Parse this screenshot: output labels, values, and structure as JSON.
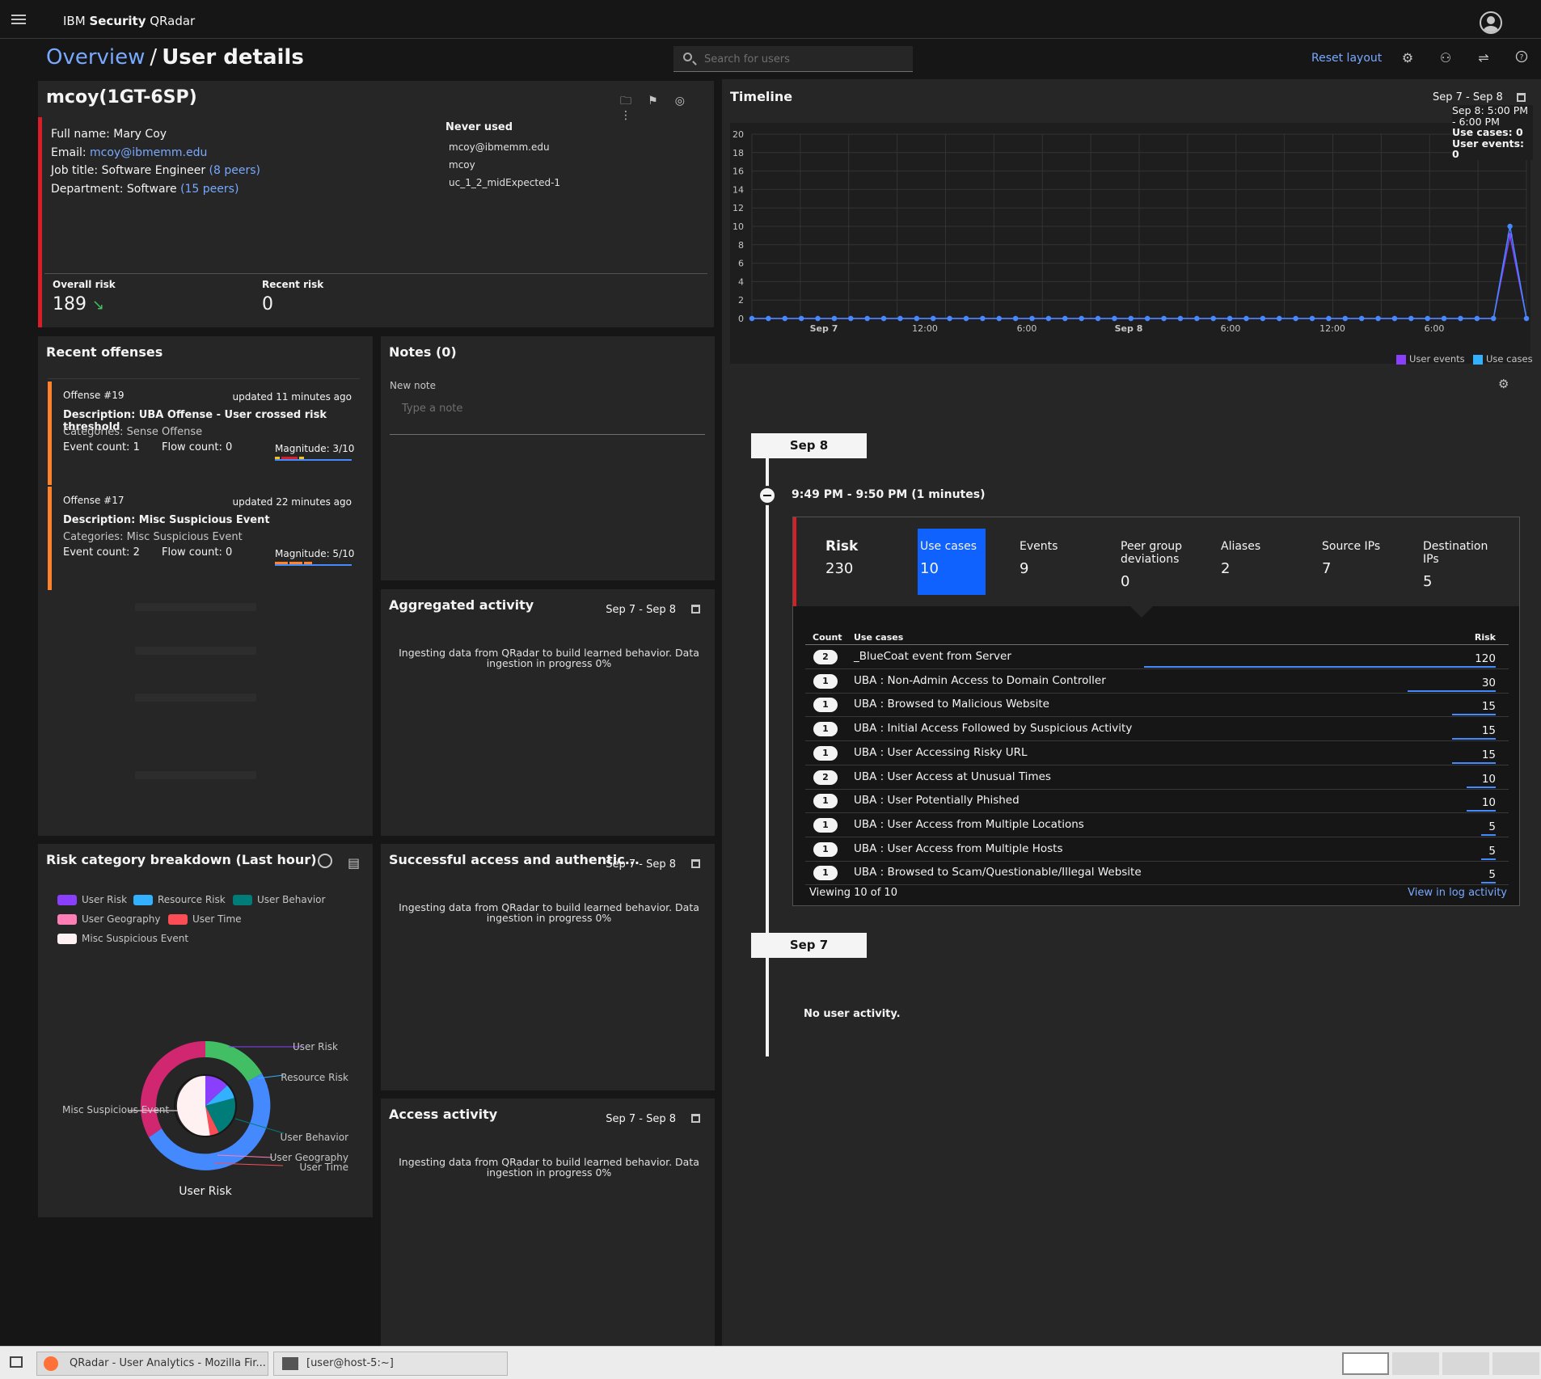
{
  "app": {
    "brand_prefix": "IBM ",
    "brand_bold": "Security",
    "brand_suffix": " QRadar"
  },
  "breadcrumb": {
    "parent": "Overview",
    "separator": "/",
    "current": "User details"
  },
  "search": {
    "placeholder": "Search for users"
  },
  "header": {
    "reset_layout": "Reset layout",
    "icons": [
      "gear-icon",
      "users-icon",
      "sliders-icon",
      "help-icon"
    ]
  },
  "user": {
    "name": "mcoy(1GT-6SP)",
    "full_name_label": "Full name:",
    "full_name": "Mary Coy",
    "email_label": "Email:",
    "email": "mcoy@ibmemm.edu",
    "job_label": "Job title:",
    "job": "Software Engineer",
    "job_peers": "(8 peers)",
    "dept_label": "Department:",
    "dept": "Software",
    "dept_peers": "(15 peers)",
    "aliases_heading": "Never used",
    "aliases": [
      "mcoy@ibmemm.edu",
      "mcoy",
      "uc_1_2_midExpected-1"
    ],
    "overall_risk_label": "Overall risk",
    "overall_risk": "189",
    "recent_risk_label": "Recent risk",
    "recent_risk": "0"
  },
  "offenses": {
    "title": "Recent offenses",
    "items": [
      {
        "id": "Offense #19",
        "updated": "updated 11 minutes ago",
        "description": "Description: UBA Offense - User crossed risk threshold",
        "categories": "Categories: Sense Offense",
        "event_count": "Event count: 1",
        "flow_count": "Flow count: 0",
        "magnitude": "Magnitude: 3/10"
      },
      {
        "id": "Offense #17",
        "updated": "updated 22 minutes ago",
        "description": "Description: Misc Suspicious Event",
        "categories": "Categories: Misc Suspicious Event",
        "event_count": "Event count: 2",
        "flow_count": "Flow count: 0",
        "magnitude": "Magnitude: 5/10"
      }
    ]
  },
  "notes": {
    "title": "Notes (0)",
    "label": "New note",
    "placeholder": "Type a note"
  },
  "activity": {
    "ingest_text": "Ingesting data from QRadar to build learned behavior. Data ingestion in progress 0%",
    "range": "Sep 7 - Sep 8",
    "aggregated_title": "Aggregated activity",
    "access_auth_title": "Successful access and authentic...",
    "access_title": "Access activity"
  },
  "risk_category": {
    "title": "Risk category breakdown (Last hour)",
    "legend": [
      {
        "label": "User Risk",
        "color": "#8a3ffc"
      },
      {
        "label": "Resource Risk",
        "color": "#33b1ff"
      },
      {
        "label": "User Behavior",
        "color": "#007d79"
      },
      {
        "label": "User Geography",
        "color": "#ff7eb6"
      },
      {
        "label": "User Time",
        "color": "#fa4d56"
      },
      {
        "label": "Misc Suspicious Event",
        "color": "#fff1f1"
      }
    ],
    "callouts": [
      "User Risk",
      "Resource Risk",
      "User Behavior",
      "User Geography",
      "User Time",
      "Misc Suspicious Event"
    ],
    "center_label": "User Risk"
  },
  "timeline": {
    "title": "Timeline",
    "range": "Sep 7 - Sep 8",
    "tooltip_time": "Sep 8: 5:00 PM - 6:00 PM",
    "tooltip_usecases": "Use cases: 0",
    "tooltip_events": "User events: 0",
    "legend_events": "User events",
    "legend_usecases": "Use cases",
    "day1": "Sep 8",
    "session": "9:49 PM - 9:50 PM (1 minutes)",
    "day2": "Sep 7",
    "no_activity": "No user activity."
  },
  "chart_data": {
    "type": "line",
    "y_ticks": [
      "0",
      "2",
      "4",
      "6",
      "8",
      "10",
      "12",
      "14",
      "16",
      "18",
      "20"
    ],
    "ylim": [
      0,
      20
    ],
    "x_tick_labels": [
      "Sep 7",
      "12:00",
      "6:00",
      "Sep 8",
      "6:00",
      "12:00",
      "6:00"
    ],
    "series": [
      {
        "name": "User events",
        "color": "#8a3ffc",
        "values": [
          0,
          0,
          0,
          0,
          0,
          0,
          0,
          0,
          0,
          0,
          0,
          0,
          0,
          0,
          0,
          0,
          0,
          0,
          0,
          0,
          0,
          0,
          0,
          0,
          0,
          0,
          0,
          0,
          0,
          0,
          0,
          0,
          0,
          0,
          0,
          0,
          0,
          0,
          0,
          0,
          0,
          0,
          0,
          0,
          0,
          0,
          9,
          0
        ]
      },
      {
        "name": "Use cases",
        "color": "#33b1ff",
        "values": [
          0,
          0,
          0,
          0,
          0,
          0,
          0,
          0,
          0,
          0,
          0,
          0,
          0,
          0,
          0,
          0,
          0,
          0,
          0,
          0,
          0,
          0,
          0,
          0,
          0,
          0,
          0,
          0,
          0,
          0,
          0,
          0,
          0,
          0,
          0,
          0,
          0,
          0,
          0,
          0,
          0,
          0,
          0,
          0,
          0,
          0,
          10,
          0
        ]
      }
    ]
  },
  "session_detail": {
    "kpis": [
      {
        "label": "Risk",
        "value": "230"
      },
      {
        "label": "Use cases",
        "value": "10"
      },
      {
        "label": "Events",
        "value": "9"
      },
      {
        "label": "Peer group deviations",
        "value": "0"
      },
      {
        "label": "Aliases",
        "value": "2"
      },
      {
        "label": "Source IPs",
        "value": "7"
      },
      {
        "label": "Destination IPs",
        "value": "5"
      }
    ],
    "col_count": "Count",
    "col_usecases": "Use cases",
    "col_risk": "Risk",
    "rows": [
      {
        "count": "2",
        "name": "_BlueCoat event from Server",
        "risk": "120",
        "risk_value": 120
      },
      {
        "count": "1",
        "name": "UBA : Non-Admin Access to Domain Controller",
        "risk": "30",
        "risk_value": 30
      },
      {
        "count": "1",
        "name": "UBA : Browsed to Malicious Website",
        "risk": "15",
        "risk_value": 15
      },
      {
        "count": "1",
        "name": "UBA : Initial Access Followed by Suspicious Activity",
        "risk": "15",
        "risk_value": 15
      },
      {
        "count": "1",
        "name": "UBA : User Accessing Risky URL",
        "risk": "15",
        "risk_value": 15
      },
      {
        "count": "2",
        "name": "UBA : User Access at Unusual Times",
        "risk": "10",
        "risk_value": 10
      },
      {
        "count": "1",
        "name": "UBA : User Potentially Phished",
        "risk": "10",
        "risk_value": 10
      },
      {
        "count": "1",
        "name": "UBA : User Access from Multiple Locations",
        "risk": "5",
        "risk_value": 5
      },
      {
        "count": "1",
        "name": "UBA : User Access from Multiple Hosts",
        "risk": "5",
        "risk_value": 5
      },
      {
        "count": "1",
        "name": "UBA : Browsed to Scam/Questionable/Illegal Website",
        "risk": "5",
        "risk_value": 5
      }
    ],
    "viewing": "Viewing 10 of 10",
    "view_log": "View in log activity"
  },
  "taskbar": {
    "task1": "QRadar - User Analytics - Mozilla Fir...",
    "task2": "[user@host-5:~]"
  }
}
